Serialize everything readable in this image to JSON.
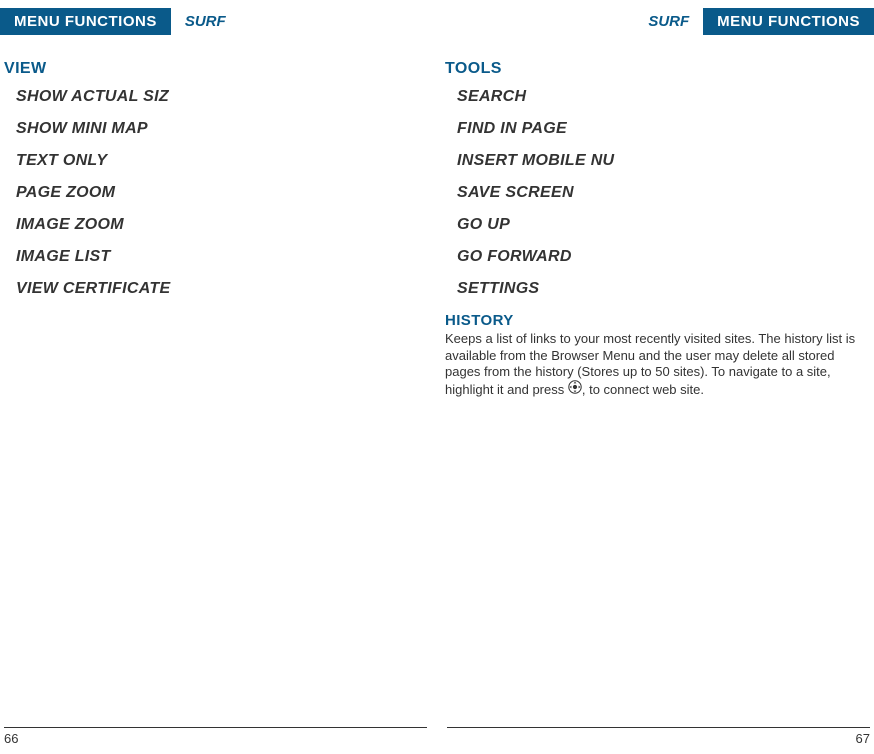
{
  "header": {
    "tab_label": "MENU FUNCTIONS",
    "section_label": "SURF"
  },
  "left_page": {
    "heading": "VIEW",
    "items": [
      "SHOW ACTUAL SIZ",
      "SHOW MINI MAP",
      "TEXT ONLY",
      "PAGE ZOOM",
      "IMAGE ZOOM",
      "IMAGE LIST",
      "VIEW CERTIFICATE"
    ],
    "page_number": "66"
  },
  "right_page": {
    "heading": "TOOLS",
    "items": [
      "SEARCH",
      "FIND IN PAGE",
      "INSERT MOBILE NU",
      "SAVE SCREEN",
      "GO UP",
      "GO FORWARD",
      "SETTINGS"
    ],
    "history": {
      "heading": "HISTORY",
      "text_before_icon": "Keeps a list of links to your most recently visited sites. The history list is available from the Browser Menu and the user may delete all stored pages from the history (Stores up to 50 sites). To navigate to a site, highlight it and press ",
      "text_after_icon": ", to connect web site."
    },
    "page_number": "67"
  }
}
